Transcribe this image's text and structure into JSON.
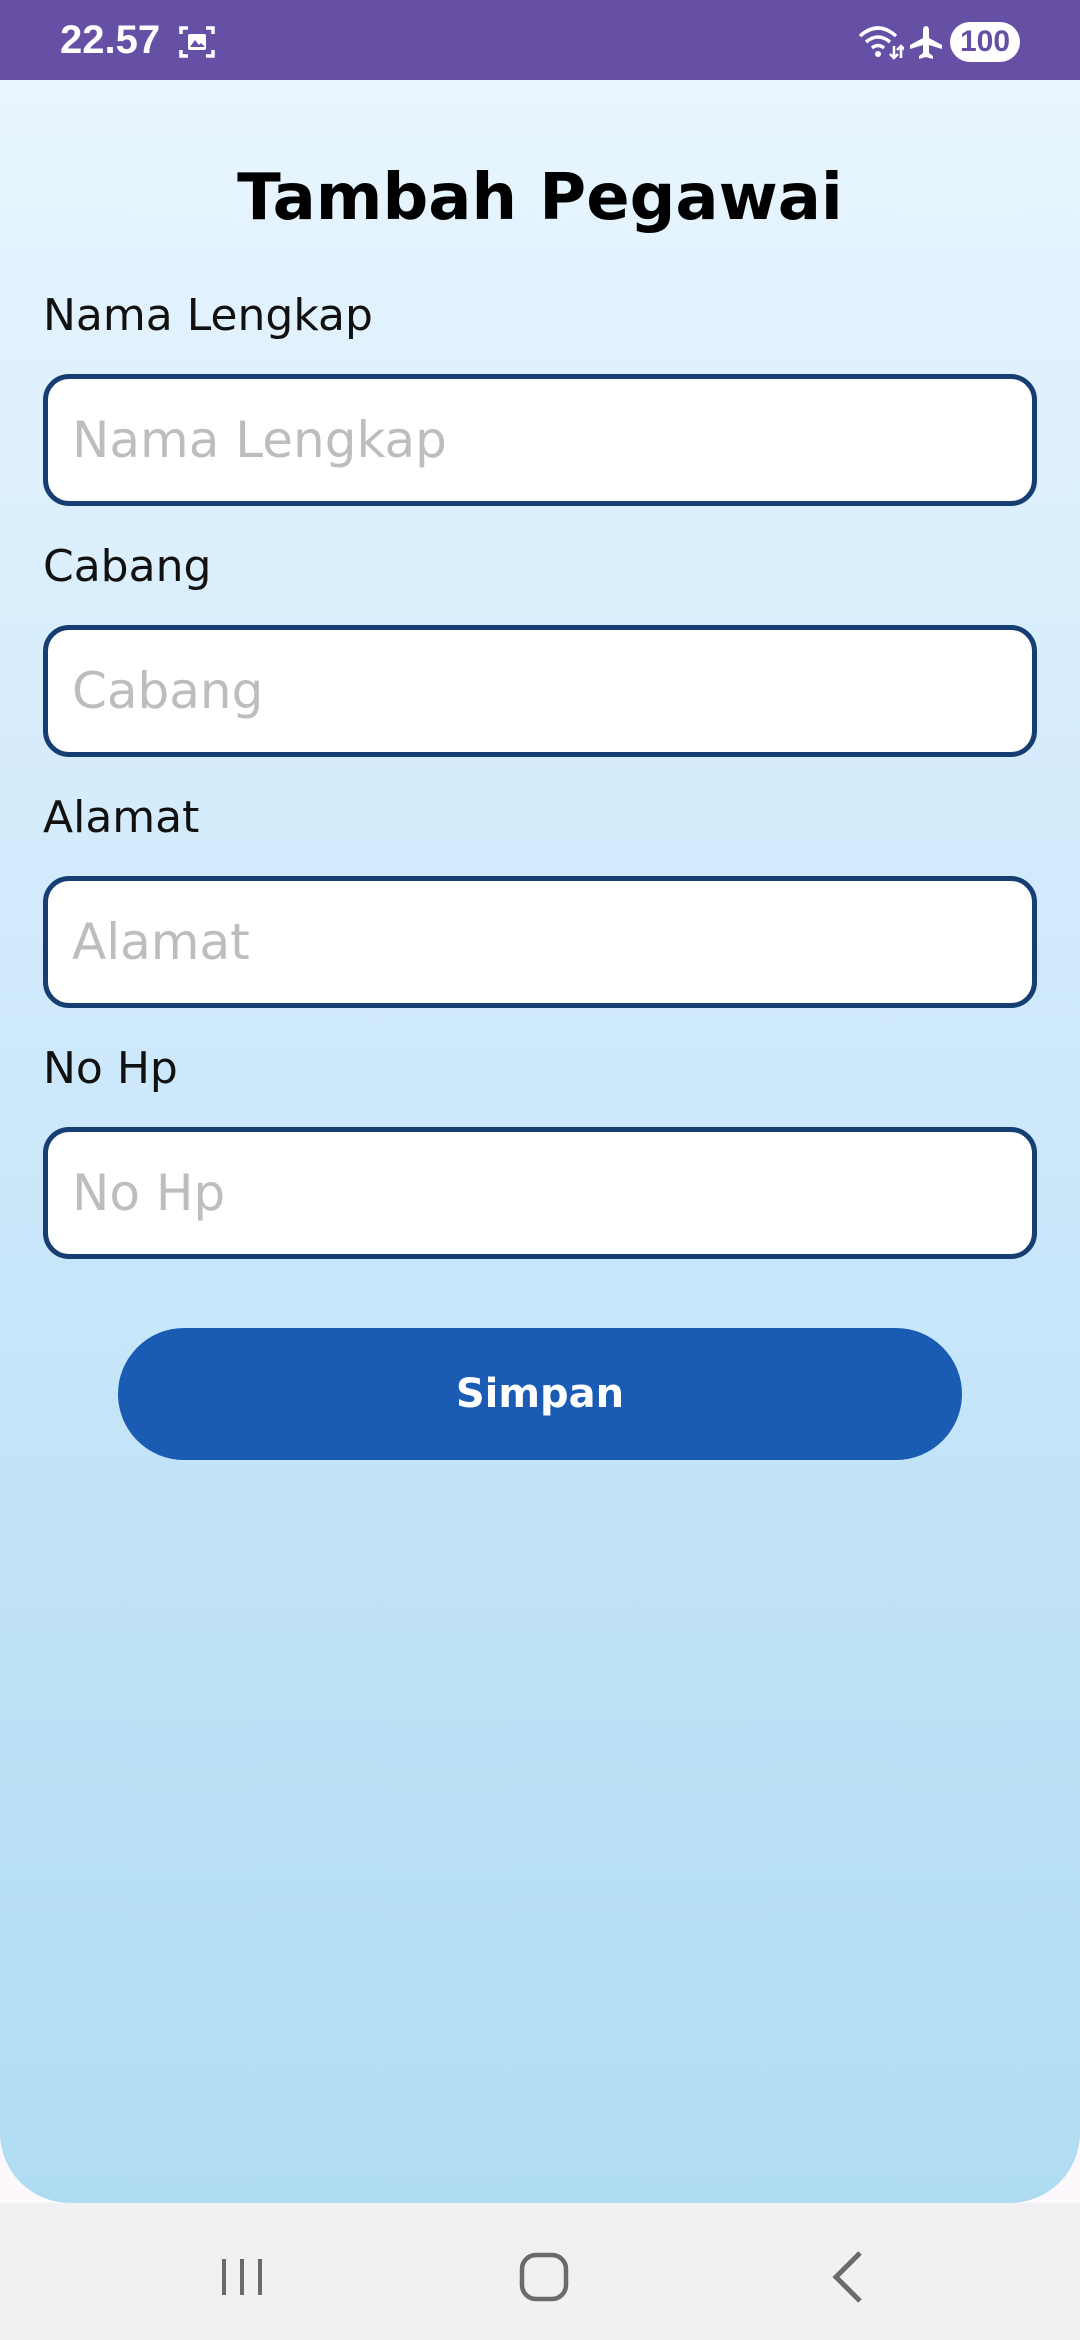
{
  "status_bar": {
    "time": "22.57",
    "battery": "100",
    "background_color": "#6650a6",
    "icons": [
      "screenshot-icon",
      "wifi-icon",
      "airplane-mode-icon"
    ]
  },
  "page": {
    "title": "Tambah Pegawai"
  },
  "form": {
    "fields": [
      {
        "label": "Nama Lengkap",
        "placeholder": "Nama Lengkap",
        "value": ""
      },
      {
        "label": "Cabang",
        "placeholder": "Cabang",
        "value": ""
      },
      {
        "label": "Alamat",
        "placeholder": "Alamat",
        "value": ""
      },
      {
        "label": "No Hp",
        "placeholder": "No Hp",
        "value": ""
      }
    ],
    "submit_label": "Simpan",
    "accent_color": "#1a5bb3",
    "border_color": "#163e73"
  },
  "nav_bar": {
    "icons": [
      "recent-apps-icon",
      "home-icon",
      "back-icon"
    ]
  }
}
